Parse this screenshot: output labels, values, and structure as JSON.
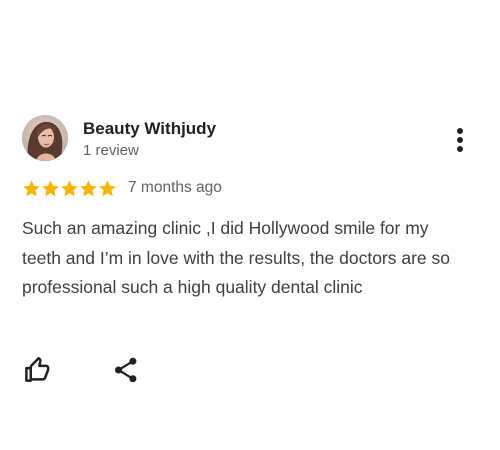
{
  "review": {
    "author_name": "Beauty Withjudy",
    "author_reviews": "1 review",
    "rating": 5,
    "max_rating": 5,
    "date": "7 months ago",
    "text": "Such an amazing clinic ,I did Hollywood smile for my teeth and I’m in love with the results, the doctors are so professional such a high quality dental clinic"
  },
  "icons": {
    "avatar": "user-photo",
    "more": "more-vertical-icon",
    "star": "star-icon",
    "like": "thumbs-up-icon",
    "share": "share-icon"
  },
  "colors": {
    "star": "#f5b400",
    "author": "#202124",
    "secondary_text": "#5f6368",
    "body_text": "#3c4043",
    "icon": "#202124"
  }
}
